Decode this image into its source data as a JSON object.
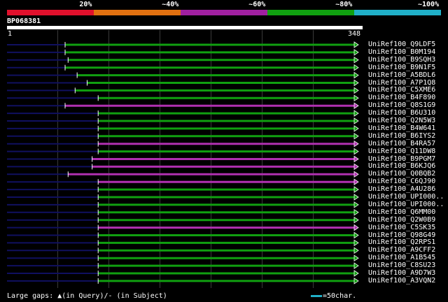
{
  "legend": {
    "bands": [
      {
        "label": "20%",
        "color": "#e0102c"
      },
      {
        "label": "~40%",
        "color": "#e07010"
      },
      {
        "label": "~60%",
        "color": "#a020a0"
      },
      {
        "label": "~80%",
        "color": "#10a010"
      },
      {
        "label": "~100%",
        "color": "#20b0c8"
      }
    ]
  },
  "query": {
    "title": "BP068381",
    "start": "1",
    "end": "348"
  },
  "colors": {
    "green": "#10a010",
    "magenta": "#b030b0",
    "navy": "#101060",
    "background": "#000000",
    "scale": "#20b0c8"
  },
  "hits": [
    {
      "label": "UniRef100_Q9LDF5",
      "color": "green",
      "start": 58,
      "end": 348
    },
    {
      "label": "UniRef100_B0M194",
      "color": "green",
      "start": 58,
      "end": 348
    },
    {
      "label": "UniRef100_B9SQH3",
      "color": "green",
      "start": 61,
      "end": 348
    },
    {
      "label": "UniRef100_B9N1F5",
      "color": "green",
      "start": 58,
      "end": 348
    },
    {
      "label": "UniRef100_A5BDL6",
      "color": "green",
      "start": 70,
      "end": 348
    },
    {
      "label": "UniRef100_A7P1Q8",
      "color": "green",
      "start": 80,
      "end": 348
    },
    {
      "label": "UniRef100_C5XME6",
      "color": "green",
      "start": 68,
      "end": 348
    },
    {
      "label": "UniRef100_B4F890",
      "color": "green",
      "start": 91,
      "end": 348
    },
    {
      "label": "UniRef100_Q8S1G9",
      "color": "magenta",
      "start": 58,
      "end": 348
    },
    {
      "label": "UniRef100_B6U310",
      "color": "green",
      "start": 91,
      "end": 348
    },
    {
      "label": "UniRef100_Q2N5W3",
      "color": "green",
      "start": 91,
      "end": 348
    },
    {
      "label": "UniRef100_B4W641",
      "color": "green",
      "start": 91,
      "end": 348
    },
    {
      "label": "UniRef100_B6IYS2",
      "color": "green",
      "start": 91,
      "end": 348
    },
    {
      "label": "UniRef100_B4RA57",
      "color": "magenta",
      "start": 91,
      "end": 348
    },
    {
      "label": "UniRef100_Q11DW8",
      "color": "green",
      "start": 91,
      "end": 348
    },
    {
      "label": "UniRef100_B9PGM7",
      "color": "magenta",
      "start": 85,
      "end": 348
    },
    {
      "label": "UniRef100_B6KJQ6",
      "color": "magenta",
      "start": 85,
      "end": 348
    },
    {
      "label": "UniRef100_Q0BQB2",
      "color": "magenta",
      "start": 61,
      "end": 348
    },
    {
      "label": "UniRef100_C6QJ90",
      "color": "magenta",
      "start": 91,
      "end": 348
    },
    {
      "label": "UniRef100_A4U286",
      "color": "green",
      "start": 91,
      "end": 348
    },
    {
      "label": "UniRef100_UPI000..",
      "color": "green",
      "start": 91,
      "end": 348
    },
    {
      "label": "UniRef100_UPI000..",
      "color": "green",
      "start": 91,
      "end": 348
    },
    {
      "label": "UniRef100_Q6MM00",
      "color": "green",
      "start": 91,
      "end": 348
    },
    {
      "label": "UniRef100_Q2W0B9",
      "color": "green",
      "start": 91,
      "end": 348
    },
    {
      "label": "UniRef100_C5SK35",
      "color": "magenta",
      "start": 91,
      "end": 348
    },
    {
      "label": "UniRef100_Q98G49",
      "color": "green",
      "start": 91,
      "end": 348
    },
    {
      "label": "UniRef100_Q2RPS1",
      "color": "green",
      "start": 91,
      "end": 348
    },
    {
      "label": "UniRef100_A9CFF2",
      "color": "green",
      "start": 91,
      "end": 348
    },
    {
      "label": "UniRef100_A1B545",
      "color": "green",
      "start": 91,
      "end": 348
    },
    {
      "label": "UniRef100_C8SU23",
      "color": "green",
      "start": 91,
      "end": 348
    },
    {
      "label": "UniRef100_A9D7W3",
      "color": "green",
      "start": 91,
      "end": 348
    },
    {
      "label": "UniRef100_A3VQN2",
      "color": "green",
      "start": 91,
      "end": 348
    }
  ],
  "footer": {
    "gaps_text": "Large gaps: ▲(in Query)/- (in Subject)",
    "scale_text": "=50char."
  }
}
